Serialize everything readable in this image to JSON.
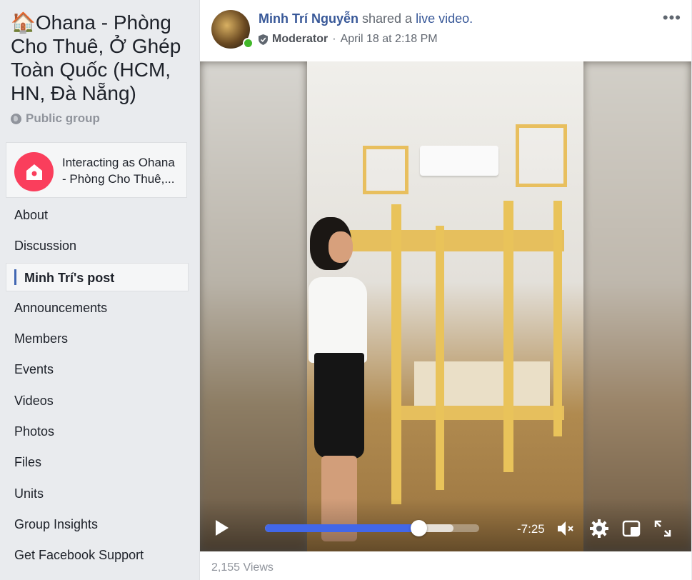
{
  "group": {
    "title_emoji": "🏠",
    "title": "Ohana - Phòng Cho Thuê, Ở Ghép Toàn Quốc (HCM, HN, Đà Nẵng)",
    "privacy": "Public group"
  },
  "interacting": {
    "line1": "Interacting as Ohana",
    "line2": "- Phòng Cho Thuê,..."
  },
  "nav": {
    "items": [
      {
        "label": "About"
      },
      {
        "label": "Discussion"
      },
      {
        "label": "Minh Trí's post"
      },
      {
        "label": "Announcements"
      },
      {
        "label": "Members"
      },
      {
        "label": "Events"
      },
      {
        "label": "Videos"
      },
      {
        "label": "Photos"
      },
      {
        "label": "Files"
      },
      {
        "label": "Units"
      },
      {
        "label": "Group Insights"
      },
      {
        "label": "Get Facebook Support"
      }
    ],
    "active_index": 2
  },
  "post": {
    "author": "Minh Trí Nguyễn",
    "action_text": " shared a ",
    "action_link": "live video.",
    "role": "Moderator",
    "separator": "·",
    "timestamp": "April 18 at 2:18 PM",
    "more": "•••"
  },
  "video": {
    "remaining_time": "-7:25",
    "progress_fraction": 0.715,
    "buffered_fraction": 0.88,
    "muted": true
  },
  "footer": {
    "views": "2,155 Views"
  },
  "colors": {
    "link": "#385898",
    "accent": "#4267b2",
    "progress": "#4267e8",
    "avatar_bg": "#fa3e5c",
    "online": "#42b72a"
  }
}
